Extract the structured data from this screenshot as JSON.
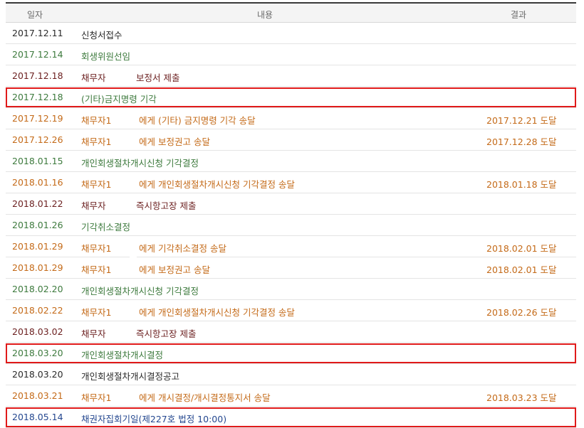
{
  "header": {
    "date": "일자",
    "content": "내용",
    "result": "결과"
  },
  "rows": [
    {
      "date": "2017.12.11",
      "text": "신청서접수"
    },
    {
      "date": "2017.12.14",
      "text": "회생위원선임"
    },
    {
      "date": "2017.12.18",
      "party": "채무자",
      "text": "보정서 제출"
    },
    {
      "date": "2017.12.18",
      "text": "(기타)금지명령 기각"
    },
    {
      "date": "2017.12.19",
      "party": "채무자1",
      "text": "에게 (기타) 금지명령 기각 송달",
      "result": "2017.12.21 도달"
    },
    {
      "date": "2017.12.26",
      "party": "채무자1",
      "text": "에게 보정권고 송달",
      "result": "2017.12.28 도달"
    },
    {
      "date": "2018.01.15",
      "text": "개인회생절차개시신청 기각결정"
    },
    {
      "date": "2018.01.16",
      "party": "채무자1",
      "text": "에게 개인회생절차개시신청 기각결정 송달",
      "result": "2018.01.18 도달"
    },
    {
      "date": "2018.01.22",
      "party": "채무자",
      "text": "즉시항고장 제출"
    },
    {
      "date": "2018.01.26",
      "text": "기각취소결정"
    },
    {
      "date": "2018.01.29",
      "party": "채무자1",
      "text": "에게 기각취소결정 송달",
      "result": "2018.02.01 도달"
    },
    {
      "date": "2018.01.29",
      "party": "채무자1",
      "text": "에게 보정권고 송달",
      "result": "2018.02.01 도달"
    },
    {
      "date": "2018.02.20",
      "text": "개인회생절차개시신청 기각결정"
    },
    {
      "date": "2018.02.22",
      "party": "채무자1",
      "text": "에게 개인회생절차개시신청 기각결정 송달",
      "result": "2018.02.26 도달"
    },
    {
      "date": "2018.03.02",
      "party": "채무자",
      "text": "즉시항고장 제출"
    },
    {
      "date": "2018.03.20",
      "text": "개인회생절차개시결정"
    },
    {
      "date": "2018.03.20",
      "text": "개인회생절차개시결정공고"
    },
    {
      "date": "2018.03.21",
      "party": "채무자1",
      "text": "에게 개시결정/개시결정통지서 송달",
      "result": "2018.03.23 도달"
    },
    {
      "date": "2018.05.14",
      "text": "채권자집회기일(제227호 법정 10:00)"
    }
  ],
  "colors": {
    "black": "#2a2a2a",
    "green": "#3d7a3d",
    "maroon": "#6b1f1f",
    "orange": "#c46a18",
    "blue": "#24478f",
    "highlight": "#e01a1a"
  }
}
